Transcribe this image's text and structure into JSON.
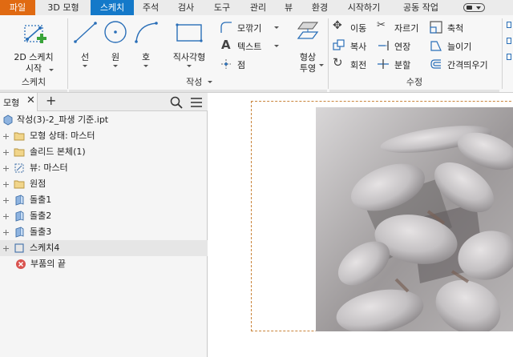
{
  "tabs": [
    {
      "label": "파일",
      "id": "file"
    },
    {
      "label": "3D 모형",
      "id": "3d-model"
    },
    {
      "label": "스케치",
      "id": "sketch"
    },
    {
      "label": "주석",
      "id": "annotate"
    },
    {
      "label": "검사",
      "id": "inspect"
    },
    {
      "label": "도구",
      "id": "tools"
    },
    {
      "label": "관리",
      "id": "manage"
    },
    {
      "label": "뷰",
      "id": "view"
    },
    {
      "label": "환경",
      "id": "environments"
    },
    {
      "label": "시작하기",
      "id": "get-started"
    },
    {
      "label": "공동 작업",
      "id": "collaborate"
    }
  ],
  "ribbon": {
    "sketch_group": {
      "start_line1": "2D 스케치",
      "start_line2": "시작",
      "label": "스케치"
    },
    "create_group": {
      "line": "선",
      "circle": "원",
      "arc": "호",
      "rectangle": "직사각형",
      "fillet": "모깎기",
      "text": "텍스트",
      "point": "점",
      "project_line1": "형상",
      "project_line2": "투영",
      "label": "작성"
    },
    "modify_group": {
      "move": "이동",
      "copy": "복사",
      "rotate": "회전",
      "trim": "자르기",
      "extend": "연장",
      "split": "분할",
      "scale": "축척",
      "stretch": "늘이기",
      "offset": "간격띄우기",
      "label": "수정"
    }
  },
  "browser": {
    "tab_label": "모형",
    "add_label": "+",
    "tree": [
      {
        "label": "작성(3)-2_파생 기준.ipt",
        "icon": "part-icon",
        "expand": false,
        "indent": 0
      },
      {
        "label": "모형 상태: 마스터",
        "icon": "folder-icon",
        "expand": true,
        "indent": 1
      },
      {
        "label": "솔리드 본체(1)",
        "icon": "folder-icon",
        "expand": true,
        "indent": 1
      },
      {
        "label": "뷰: 마스터",
        "icon": "view-icon",
        "expand": true,
        "indent": 1
      },
      {
        "label": "원점",
        "icon": "folder-icon",
        "expand": true,
        "indent": 1
      },
      {
        "label": "돌출1",
        "icon": "extrude-icon",
        "expand": true,
        "indent": 1
      },
      {
        "label": "돌출2",
        "icon": "extrude-icon",
        "expand": true,
        "indent": 1
      },
      {
        "label": "돌출3",
        "icon": "extrude-icon",
        "expand": true,
        "indent": 1
      },
      {
        "label": "스케치4",
        "icon": "sketch-icon",
        "expand": true,
        "indent": 1,
        "selected": true
      },
      {
        "label": "부품의 끝",
        "icon": "end-of-part-icon",
        "expand": false,
        "indent": 1
      }
    ]
  },
  "colors": {
    "file_tab": "#e06a12",
    "active_tab": "#1479c9",
    "sketch_frame": "#c9843a"
  }
}
